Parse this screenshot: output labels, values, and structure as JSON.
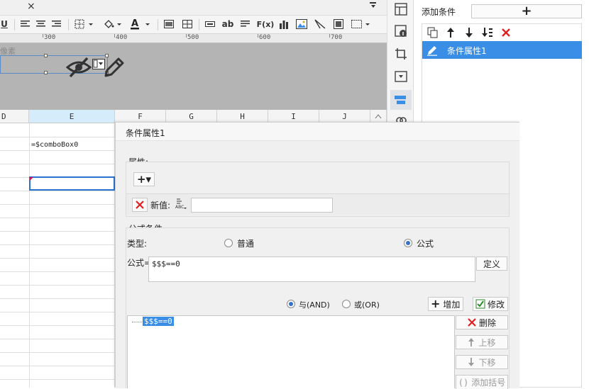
{
  "toolbar": {
    "close_glyph": "×",
    "underline_label": "U",
    "text_ab_label": "ab",
    "formula_label": "F(x)"
  },
  "ruler": {
    "ticks": [
      "300",
      "400",
      "500",
      "600",
      "700"
    ]
  },
  "canvas": {
    "hint_text": "像素"
  },
  "grid": {
    "columns": [
      "D",
      "E",
      "F",
      "G",
      "H",
      "I",
      "J"
    ],
    "selected_column": "E",
    "cell_formula": "=$comboBox0"
  },
  "cond_panel": {
    "add_label": "添加条件",
    "add_button_glyph": "+",
    "items": [
      {
        "label": "条件属性1",
        "selected": true
      }
    ]
  },
  "dialog": {
    "title": "条件属性1",
    "attr_group_label": "属性:",
    "add_attr_glyph": "+▾",
    "new_value_label": "新值:",
    "new_value": "",
    "formula_group_label": "公式条件",
    "type_label": "类型:",
    "type_options": [
      {
        "label": "普通",
        "checked": false
      },
      {
        "label": "公式",
        "checked": true
      }
    ],
    "formula_label": "公式=",
    "formula_value": "$$$==0",
    "define_button": "定义",
    "logic_options": [
      {
        "label": "与(AND)",
        "checked": true
      },
      {
        "label": "或(OR)",
        "checked": false
      }
    ],
    "add_button": "增加",
    "modify_button": "修改",
    "condition_items": [
      "$$$==0"
    ],
    "delete_button": "删除",
    "move_up_button": "上移",
    "move_down_button": "下移",
    "add_bracket_button": "添加括号"
  },
  "colors": {
    "accent": "#3a8ee6",
    "selection_border": "#2a73d0",
    "delete_red": "#e02020"
  }
}
